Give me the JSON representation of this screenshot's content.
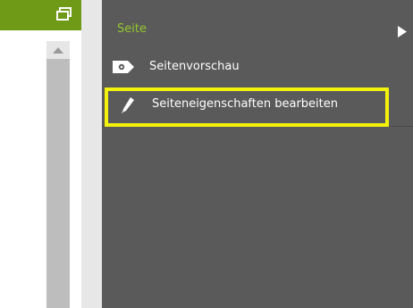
{
  "menu": {
    "section_title": "Seite",
    "items": [
      {
        "label": "Seitenvorschau",
        "icon": "eye-tag-icon"
      },
      {
        "label": "Seiteneigenschaften bearbeiten",
        "icon": "pencil-icon"
      }
    ]
  },
  "colors": {
    "accent_green": "#6e9a18",
    "section_title_green": "#94c72a",
    "menu_bg": "#5a5a5a",
    "highlight": "#f3f20a"
  }
}
